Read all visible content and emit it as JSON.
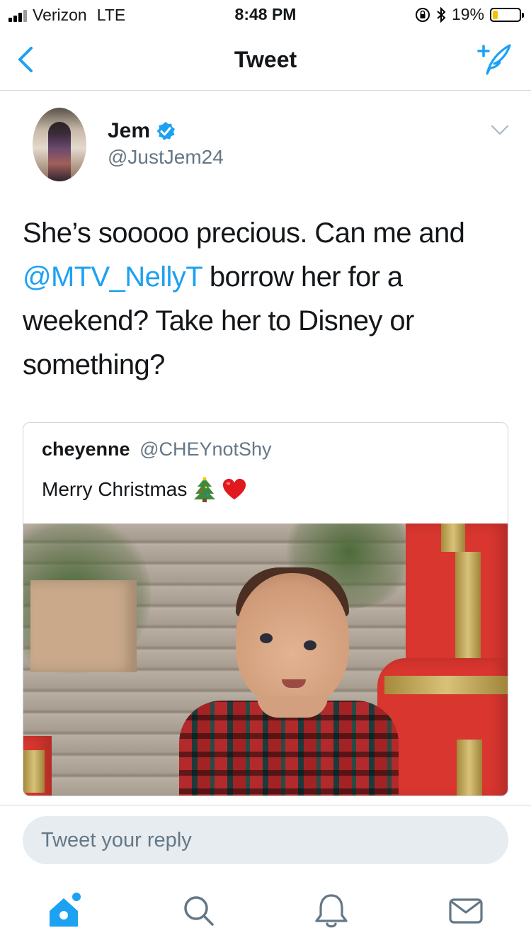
{
  "status_bar": {
    "carrier": "Verizon",
    "network": "LTE",
    "time": "8:48 PM",
    "battery_percent": "19%",
    "battery_level": 0.19
  },
  "nav": {
    "title": "Tweet",
    "back_icon": "chevron-left-icon",
    "compose_icon": "compose-tweet-icon"
  },
  "tweet": {
    "author_name": "Jem",
    "author_handle": "@JustJem24",
    "verified": true,
    "text_part1": "She’s sooooo precious. Can me and ",
    "mention": "@MTV_NellyT",
    "text_part2": " borrow her for a weekend? Take her to Disney or something?"
  },
  "quoted_tweet": {
    "author_name": "cheyenne",
    "author_handle": "@CHEYnotShy",
    "text": "Merry Christmas",
    "emojis": [
      "christmas-tree-icon",
      "red-heart-icon"
    ]
  },
  "reply": {
    "placeholder": "Tweet your reply"
  },
  "tab_bar": {
    "items": [
      "home-icon",
      "search-icon",
      "notifications-icon",
      "messages-icon"
    ],
    "active": "home-icon",
    "accent": "#1da1f2"
  },
  "colors": {
    "accent": "#1da1f2",
    "text": "#14171a",
    "secondary": "#657786"
  }
}
